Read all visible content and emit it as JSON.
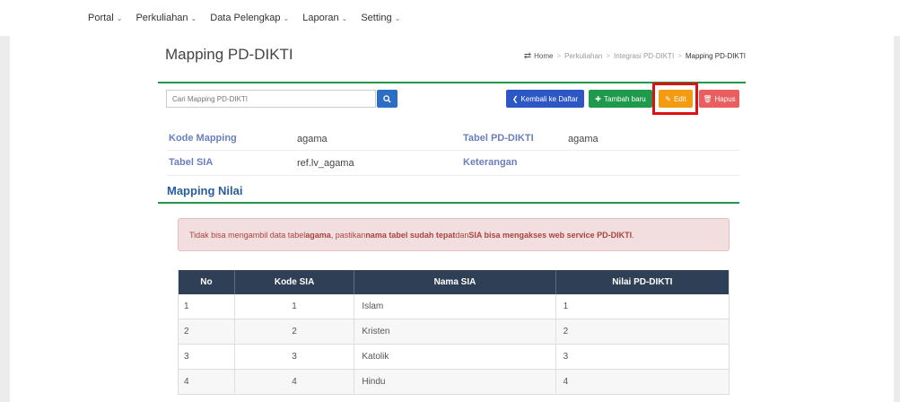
{
  "nav": {
    "items": [
      {
        "label": "Portal"
      },
      {
        "label": "Perkuliahan"
      },
      {
        "label": "Data Pelengkap"
      },
      {
        "label": "Laporan"
      },
      {
        "label": "Setting"
      }
    ]
  },
  "page": {
    "title": "Mapping PD-DIKTI"
  },
  "breadcrumb": {
    "home": "Home",
    "items": [
      "Perkuliahan",
      "Integrasi PD-DIKTI"
    ],
    "active": "Mapping PD-DIKTI",
    "separator": ">"
  },
  "search": {
    "placeholder": "Cari Mapping PD-DIKTI"
  },
  "actions": {
    "back": "Kembali ke Daftar",
    "add": "Tambah baru",
    "edit": "Edit",
    "delete": "Hapus"
  },
  "info": {
    "kode_mapping_label": "Kode Mapping",
    "kode_mapping_value": "agama",
    "tabel_pddikti_label": "Tabel PD-DIKTI",
    "tabel_pddikti_value": "agama",
    "tabel_sia_label": "Tabel SIA",
    "tabel_sia_value": "ref.lv_agama",
    "keterangan_label": "Keterangan",
    "keterangan_value": ""
  },
  "section": {
    "title": "Mapping Nilai"
  },
  "alert": {
    "p1": "Tidak bisa mengambil data tabel ",
    "b1": "agama",
    "p2": ", pastikan ",
    "b2": "nama tabel sudah tepat",
    "p3": " dan ",
    "b3": "SIA bisa mengakses web service PD-DIKTI",
    "p4": "."
  },
  "table": {
    "headers": [
      "No",
      "Kode SIA",
      "Nama SIA",
      "Nilai PD-DIKTI"
    ],
    "rows": [
      [
        "1",
        "1",
        "Islam",
        "1"
      ],
      [
        "2",
        "2",
        "Kristen",
        "2"
      ],
      [
        "3",
        "3",
        "Katolik",
        "3"
      ],
      [
        "4",
        "4",
        "Hindu",
        "4"
      ]
    ]
  },
  "colors": {
    "accent_green": "#1f9a4d",
    "primary_blue": "#2d57c5",
    "edit_orange": "#f39c12",
    "delete_red": "#e95f5f",
    "highlight_red": "#e01010"
  }
}
